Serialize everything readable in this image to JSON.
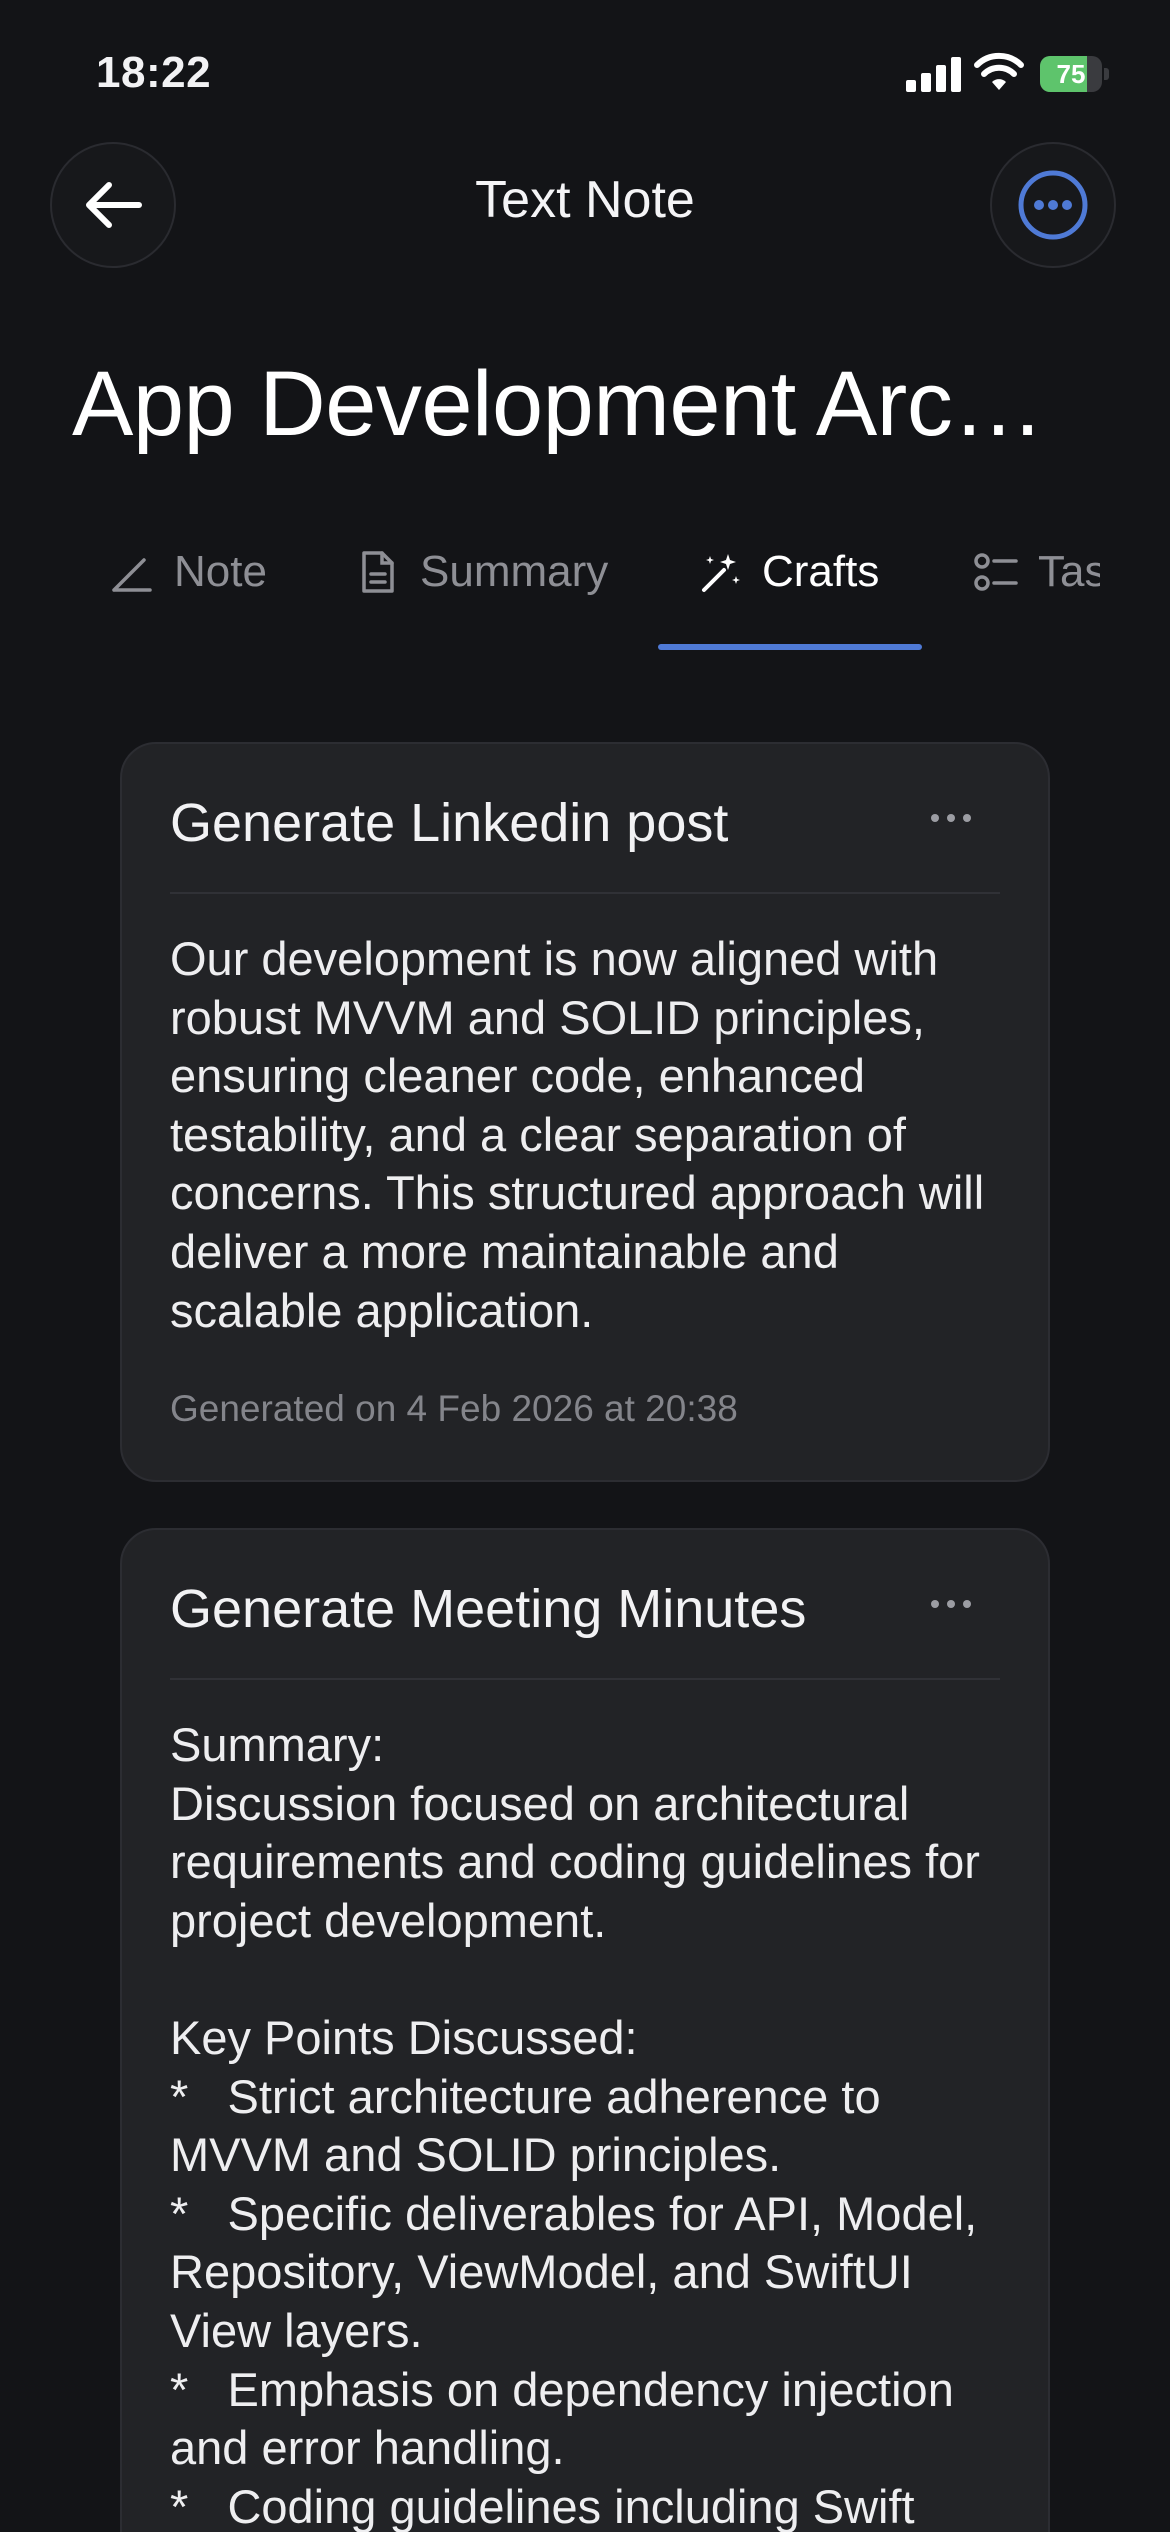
{
  "status_bar": {
    "time": "18:22",
    "battery_level": "75",
    "battery_fraction": 0.75,
    "battery_color": "#5ec46c"
  },
  "header": {
    "title": "Text Note",
    "back_icon": "arrow-left-icon",
    "more_icon": "ellipsis-circle-icon",
    "accent_color": "#4f7ad6"
  },
  "note": {
    "title": "App Development Architecture"
  },
  "tabs": [
    {
      "label": "Note",
      "icon": "pencil-icon",
      "active": false
    },
    {
      "label": "Summary",
      "icon": "document-icon",
      "active": false
    },
    {
      "label": "Crafts",
      "icon": "magic-wand-icon",
      "active": true
    },
    {
      "label": "Tasks",
      "icon": "checklist-icon",
      "active": false
    }
  ],
  "crafts": [
    {
      "title": "Generate Linkedin post",
      "body": "Our development is now aligned with robust MVVM and SOLID principles, ensuring cleaner code, enhanced testability, and a clear separation of concerns. This structured approach will deliver a more maintainable and scalable application.",
      "footer": "Generated on 4 Feb 2026 at 20:38"
    },
    {
      "title": "Generate Meeting Minutes",
      "body": "Summary:\nDiscussion focused on architectural requirements and coding guidelines for project development.\n\nKey Points Discussed:\n*   Strict architecture adherence to MVVM and SOLID principles.\n*   Specific deliverables for API, Model, Repository, ViewModel, and SwiftUI View layers.\n*   Emphasis on dependency injection and error handling.\n*   Coding guidelines including Swift"
    }
  ]
}
